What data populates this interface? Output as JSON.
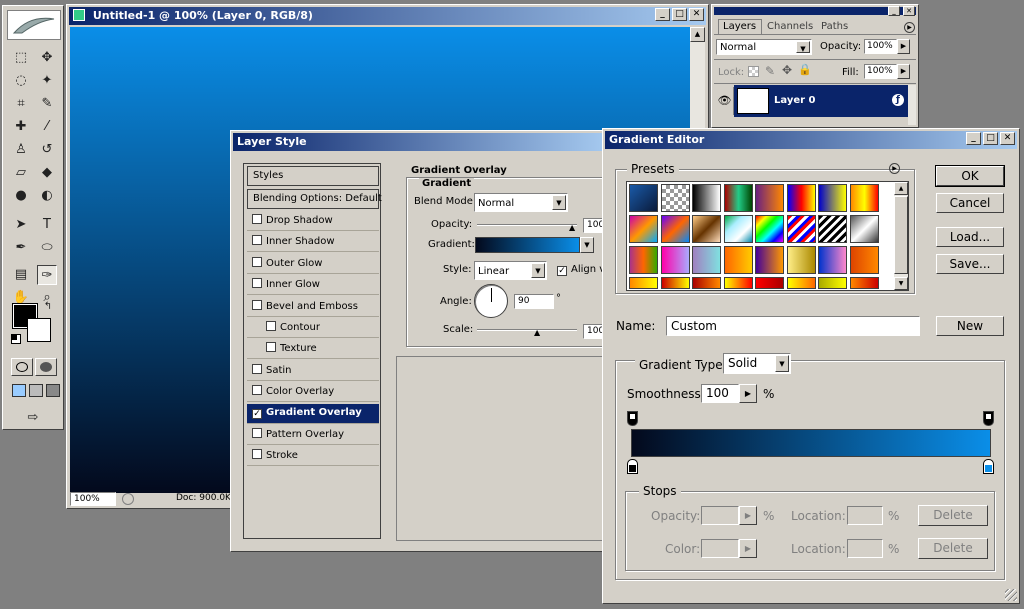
{
  "toolbox": {
    "tools": [
      "marquee-icon",
      "move-icon",
      "lasso-icon",
      "magic-wand-icon",
      "crop-icon",
      "slice-icon",
      "healing-icon",
      "brush-icon",
      "stamp-icon",
      "history-brush-icon",
      "eraser-icon",
      "paint-bucket-icon",
      "blur-icon",
      "dodge-icon",
      "path-select-icon",
      "type-icon",
      "pen-icon",
      "shape-icon",
      "notes-icon",
      "eyedropper-icon",
      "hand-icon",
      "zoom-icon"
    ]
  },
  "document": {
    "title": "Untitled-1 @ 100% (Layer 0, RGB/8)",
    "zoom": "100%",
    "doc_info": "Doc: 900.0K/"
  },
  "layers_panel": {
    "tabs": [
      "Layers",
      "Channels",
      "Paths"
    ],
    "blend_mode": "Normal",
    "opacity_label": "Opacity:",
    "opacity_value": "100%",
    "lock_label": "Lock:",
    "fill_label": "Fill:",
    "fill_value": "100%",
    "layer_name": "Layer 0"
  },
  "layer_style": {
    "title": "Layer Style",
    "styles_header": "Styles",
    "blending_options": "Blending Options: Default",
    "items": [
      {
        "label": "Drop Shadow",
        "checked": false
      },
      {
        "label": "Inner Shadow",
        "checked": false
      },
      {
        "label": "Outer Glow",
        "checked": false
      },
      {
        "label": "Inner Glow",
        "checked": false
      },
      {
        "label": "Bevel and Emboss",
        "checked": false
      },
      {
        "label": "Contour",
        "checked": false
      },
      {
        "label": "Texture",
        "checked": false
      },
      {
        "label": "Satin",
        "checked": false
      },
      {
        "label": "Color Overlay",
        "checked": false
      },
      {
        "label": "Gradient Overlay",
        "checked": true
      },
      {
        "label": "Pattern Overlay",
        "checked": false
      },
      {
        "label": "Stroke",
        "checked": false
      }
    ],
    "section_title": "Gradient Overlay",
    "group_title": "Gradient",
    "blend_mode_label": "Blend Mode:",
    "blend_mode_value": "Normal",
    "opacity_label": "Opacity:",
    "opacity_value": "100",
    "gradient_label": "Gradient:",
    "style_label": "Style:",
    "style_value": "Linear",
    "align_label": "Align v",
    "angle_label": "Angle:",
    "angle_value": "90",
    "angle_unit": "°",
    "scale_label": "Scale:",
    "scale_value": "100"
  },
  "gradient_editor": {
    "title": "Gradient Editor",
    "presets_label": "Presets",
    "ok": "OK",
    "cancel": "Cancel",
    "load": "Load...",
    "save": "Save...",
    "name_label": "Name:",
    "name_value": "Custom",
    "new_label": "New",
    "gradient_type_label": "Gradient Type:",
    "gradient_type_value": "Solid",
    "smoothness_label": "Smoothness:",
    "smoothness_value": "100",
    "smoothness_unit": "%",
    "stops_label": "Stops",
    "opacity_label": "Opacity:",
    "color_label": "Color:",
    "location_label": "Location:",
    "percent": "%",
    "delete_label": "Delete",
    "gradient_start_color": "#03091c",
    "gradient_end_color": "#0a8ee8"
  }
}
